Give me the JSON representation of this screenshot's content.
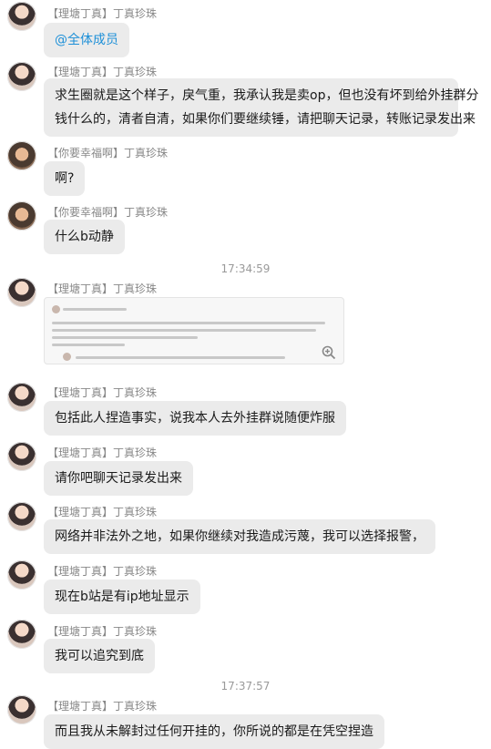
{
  "messages": [
    {
      "sender": "【理塘丁真】丁真珍珠",
      "text": "@全体成员"
    },
    {
      "sender": "【理塘丁真】丁真珍珠",
      "text_lines": [
        "求生圈就是这个样子，戾气重，我承认我是卖op，但也没有坏到给外挂群分",
        "钱什么的，清者自清，如果你们要继续锤，请把聊天记录，转账记录发出来"
      ]
    },
    {
      "sender": "【你要幸福啊】丁真珍珠",
      "text": "啊?"
    },
    {
      "sender": "【你要幸福啊】丁真珍珠",
      "text": "什么b动静"
    },
    {
      "time": "17:34:59"
    },
    {
      "sender": "【理塘丁真】丁真珍珠",
      "image": "screenshot"
    },
    {
      "sender": "【理塘丁真】丁真珍珠",
      "text": "包括此人捏造事实，说我本人去外挂群说随便炸服"
    },
    {
      "sender": "【理塘丁真】丁真珍珠",
      "text": "请你吧聊天记录发出来"
    },
    {
      "sender": "【理塘丁真】丁真珍珠",
      "text": "网络并非法外之地，如果你继续对我造成污蔑，我可以选择报警，"
    },
    {
      "sender": "【理塘丁真】丁真珍珠",
      "text": "现在b站是有ip地址显示"
    },
    {
      "sender": "【理塘丁真】丁真珍珠",
      "text": "我可以追究到底"
    },
    {
      "time": "17:37:57"
    },
    {
      "sender": "【理塘丁真】丁真珍珠",
      "text": "而且我从未解封过任何开挂的，你所说的都是在凭空捏造"
    }
  ],
  "icons": {
    "zoom": "zoom-in-icon"
  }
}
